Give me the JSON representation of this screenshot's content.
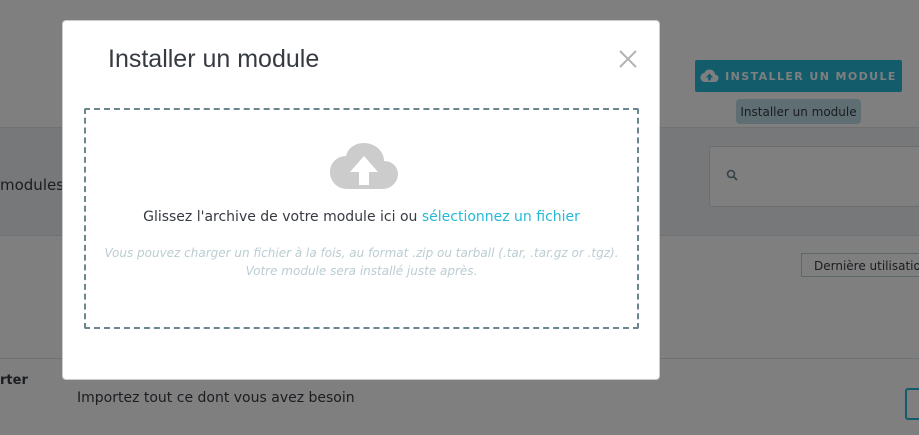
{
  "header": {
    "install_button_label": "INSTALLER UN MODULE",
    "install_button_icon": "cloud-upload-icon",
    "tooltip": "Installer un module"
  },
  "filter": {
    "modules_label": "modules",
    "search_icon": "search-icon"
  },
  "sort": {
    "selected": "Dernière utilisation"
  },
  "row": {
    "title": "rter",
    "description": "Importez tout ce dont vous avez besoin"
  },
  "modal": {
    "title": "Installer un module",
    "close_icon": "close-icon",
    "upload_icon": "cloud-upload-icon",
    "drop_text": "Glissez l'archive de votre module ici ou ",
    "drop_link": "sélectionnez un fichier",
    "help_text": "Vous pouvez charger un fichier à la fois, au format .zip ou tarball (.tar, .tar.gz or .tgz). Votre module sera installé juste après."
  },
  "colors": {
    "accent": "#25b9d7",
    "dropzone_border": "#6c868e",
    "help_text": "#bbcdd2",
    "overlay": "rgba(0,0,0,0.5)"
  }
}
